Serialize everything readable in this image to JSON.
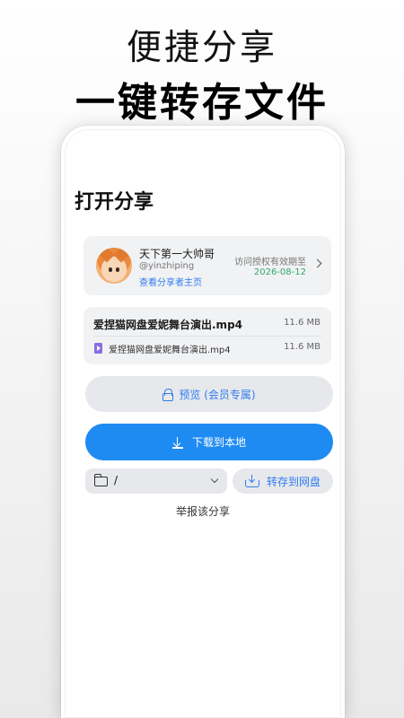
{
  "banner": {
    "line1": "便捷分享",
    "line2": "一键转存文件"
  },
  "page": {
    "title": "打开分享"
  },
  "sharer": {
    "name": "天下第一大帅哥",
    "handle": "@yinzhiping",
    "profile_link": "查看分享者主页",
    "access_label": "访问授权有效期至",
    "access_date": "2026-08-12"
  },
  "files": {
    "folder": {
      "name": "爱捏猫网盘爱妮舞台演出.mp4",
      "size": "11.6 MB"
    },
    "items": [
      {
        "name": "爱捏猫网盘爱妮舞台演出.mp4",
        "size": "11.6 MB",
        "icon": "video-file-icon"
      }
    ]
  },
  "actions": {
    "preview_label": "预览 (会员专属)",
    "download_label": "下载到本地",
    "save_label": "转存到网盘",
    "path_value": "/",
    "report_label": "举报该分享"
  },
  "colors": {
    "accent": "#1e8bf2",
    "link": "#2f7cf0",
    "date": "#2fa86a"
  }
}
